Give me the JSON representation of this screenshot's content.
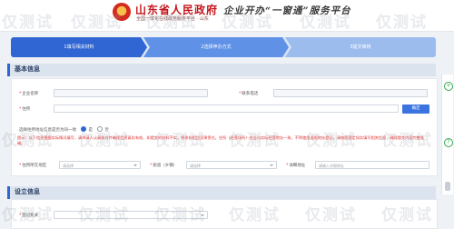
{
  "header": {
    "gov_title": "山东省人民政府",
    "gov_subtitle": "全国一体化在线政务服务平台 · 山东",
    "slogan": "企业开办“一窗通”服务平台"
  },
  "steps": [
    {
      "label": "1填写相关材料"
    },
    {
      "label": "2选择申办方式"
    },
    {
      "label": "3提交审核"
    }
  ],
  "sections": {
    "basic_info": "基本信息",
    "establish_info": "设立信息"
  },
  "form": {
    "enterprise_name_label": "企业名称",
    "enterprise_name_value": "",
    "contact_phone_label": "联系电话",
    "contact_phone_value": "",
    "address_label": "住所",
    "address_value": "",
    "confirm_button": "确定",
    "radio_label": "选择住所地址信息是否为同一地",
    "radio_options": [
      "是",
      "否"
    ],
    "notice": "提示：以下信息根据实际情况填写，请申请人认真核对并确保信息真实有效，如提交的材料不实，将承担相应法律责任。住所（经营场所）应当与实际经营地址一致，不得使用虚假地址登记，请按照规定如实填写相关信息，确保提交内容完整准确。",
    "region_label": "住所所在地区",
    "region_placeholder": "请选择",
    "street_label": "街道（乡镇）",
    "street_placeholder": "请选择",
    "detail_label": "详细地址",
    "detail_placeholder": "请输入详细地址"
  },
  "establish": {
    "field_label": "登记机关"
  },
  "watermark_text": "仅测试",
  "side_tools": [
    "+",
    "?"
  ]
}
